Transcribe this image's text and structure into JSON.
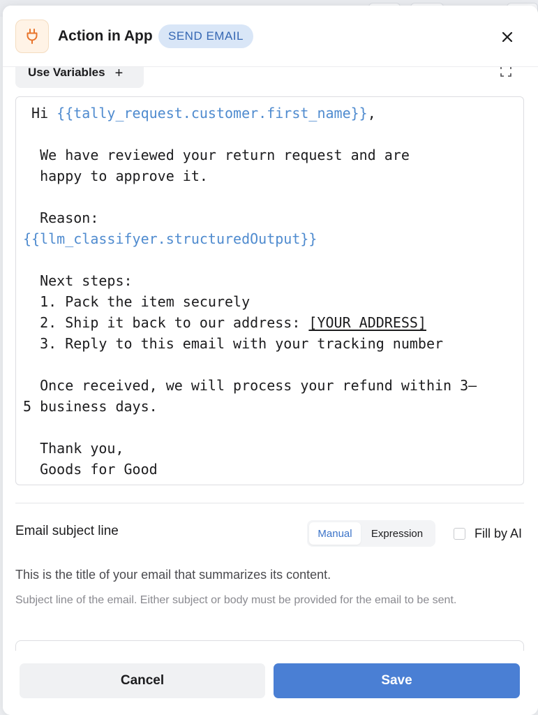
{
  "header": {
    "title": "Action in App",
    "badge": "SEND EMAIL",
    "icon": "plug-icon",
    "close_icon": "close-icon"
  },
  "toolbar": {
    "use_variables_label": "Use Variables",
    "plus_label": "+"
  },
  "email_body": {
    "lines": [
      {
        "parts": [
          {
            "text": " Hi "
          },
          {
            "text": "{{tally_request.customer.first_name}}",
            "var": true
          },
          {
            "text": ","
          }
        ]
      },
      {
        "parts": [
          {
            "text": ""
          }
        ]
      },
      {
        "parts": [
          {
            "text": "  We have reviewed your return request and are"
          }
        ]
      },
      {
        "parts": [
          {
            "text": "  happy to approve it."
          }
        ]
      },
      {
        "parts": [
          {
            "text": ""
          }
        ]
      },
      {
        "parts": [
          {
            "text": "  Reason:"
          }
        ]
      },
      {
        "parts": [
          {
            "text": "{{llm_classifyer.structuredOutput}}",
            "var": true
          }
        ]
      },
      {
        "parts": [
          {
            "text": ""
          }
        ]
      },
      {
        "parts": [
          {
            "text": "  Next steps:"
          }
        ]
      },
      {
        "parts": [
          {
            "text": "  1. Pack the item securely"
          }
        ]
      },
      {
        "parts": [
          {
            "text": "  2. Ship it back to our address: "
          },
          {
            "text": "[YOUR ADDRESS]",
            "underline": true
          }
        ]
      },
      {
        "parts": [
          {
            "text": "  3. Reply to this email with your tracking number"
          }
        ]
      },
      {
        "parts": [
          {
            "text": ""
          }
        ]
      },
      {
        "parts": [
          {
            "text": "  Once received, we will process your refund within 3–"
          }
        ]
      },
      {
        "parts": [
          {
            "text": "5 business days."
          }
        ]
      },
      {
        "parts": [
          {
            "text": ""
          }
        ]
      },
      {
        "parts": [
          {
            "text": "  Thank you,"
          }
        ]
      },
      {
        "parts": [
          {
            "text": "  Goods for Good"
          }
        ]
      }
    ]
  },
  "subject": {
    "label": "Email subject line",
    "mode_manual": "Manual",
    "mode_expression": "Expression",
    "fill_by_ai_label": "Fill by AI",
    "fill_by_ai_checked": false,
    "description": "This is the title of your email that summarizes its content.",
    "hint": "Subject line of the email. Either subject or body must be provided for the email to be sent."
  },
  "footer": {
    "cancel_label": "Cancel",
    "save_label": "Save"
  },
  "colors": {
    "accent": "#4a7fd4",
    "variable": "#4f8bcf",
    "badge_bg": "#d9e6f7",
    "badge_text": "#3567b3",
    "icon_orange": "#e8742b"
  }
}
